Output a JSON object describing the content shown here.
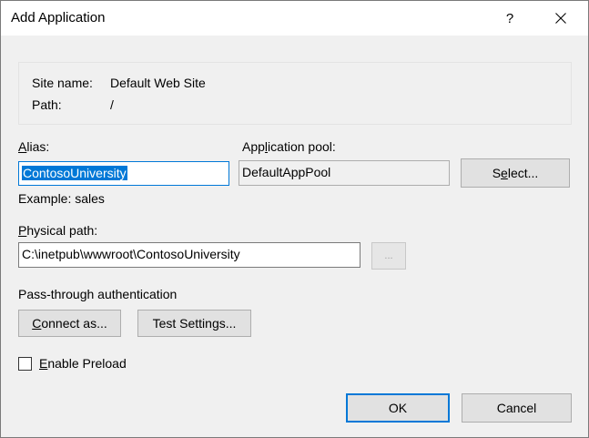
{
  "window": {
    "title": "Add Application",
    "help_glyph": "?",
    "close_icon": "close-icon"
  },
  "site_info": {
    "site_name_label": "Site name:",
    "site_name_value": "Default Web Site",
    "path_label": "Path:",
    "path_value": "/"
  },
  "alias": {
    "label_accel": "A",
    "label_rest": "lias:",
    "value": "ContosoUniversity",
    "example": "Example: sales"
  },
  "app_pool": {
    "label_pre": "App",
    "label_accel": "l",
    "label_post": "ication pool:",
    "value": "DefaultAppPool",
    "select_pre": "S",
    "select_accel": "e",
    "select_post": "lect..."
  },
  "physical_path": {
    "label_accel": "P",
    "label_rest": "hysical path:",
    "value": "C:\\inetpub\\wwwroot\\ContosoUniversity",
    "browse_label": "..."
  },
  "auth": {
    "heading": "Pass-through authentication",
    "connect_accel": "C",
    "connect_rest": "onnect as...",
    "test_label": "Test Settings..."
  },
  "preload": {
    "accel": "E",
    "rest": "nable Preload",
    "checked": false
  },
  "footer": {
    "ok_label": "OK",
    "cancel_label": "Cancel"
  },
  "colors": {
    "accent": "#0078d7",
    "dialog_bg": "#f0f0f0",
    "button_bg": "#e1e1e1"
  }
}
